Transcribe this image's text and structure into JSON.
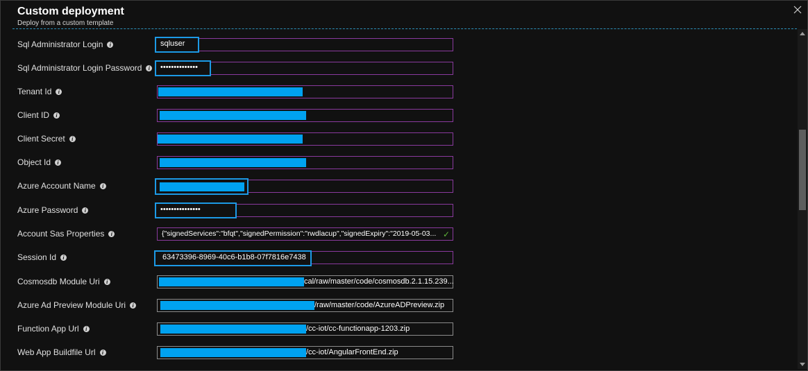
{
  "blade": {
    "title": "Custom deployment",
    "subtitle": "Deploy from a custom template"
  },
  "icons": {
    "close": "close-icon",
    "info": "info-icon",
    "check": "checkmark-icon"
  },
  "colors": {
    "accent": "#00a2f0",
    "field_border": "#8a3a9e",
    "highlight": "#1c9ae6",
    "valid": "#5fb53b"
  },
  "fields": [
    {
      "label": "Sql Administrator Login",
      "value": "sqluser"
    },
    {
      "label": "Sql Administrator Login Password",
      "value": "••••••••••••••"
    },
    {
      "label": "Tenant Id",
      "value": ""
    },
    {
      "label": "Client ID",
      "value": ""
    },
    {
      "label": "Client Secret",
      "value": ""
    },
    {
      "label": "Object Id",
      "value": ""
    },
    {
      "label": "Azure Account Name",
      "value": ""
    },
    {
      "label": "Azure Password",
      "value": "•••••••••••••••"
    },
    {
      "label": "Account Sas Properties",
      "value": "{\"signedServices\":\"bfqt\",\"signedPermission\":\"rwdlacup\",\"signedExpiry\":\"2019-05-03..."
    },
    {
      "label": "Session Id",
      "value": "63473396-8969-40c6-b1b8-07f7816e7438"
    },
    {
      "label": "Cosmosdb Module Uri",
      "value": "cal/raw/master/code/cosmosdb.2.1.15.239..."
    },
    {
      "label": "Azure Ad Preview Module Uri",
      "value": "/raw/master/code/AzureADPreview.zip"
    },
    {
      "label": "Function App Url",
      "value": "/cc-iot/cc-functionapp-1203.zip"
    },
    {
      "label": "Web App Buildfile Url",
      "value": "/cc-iot/AngularFrontEnd.zip"
    }
  ]
}
